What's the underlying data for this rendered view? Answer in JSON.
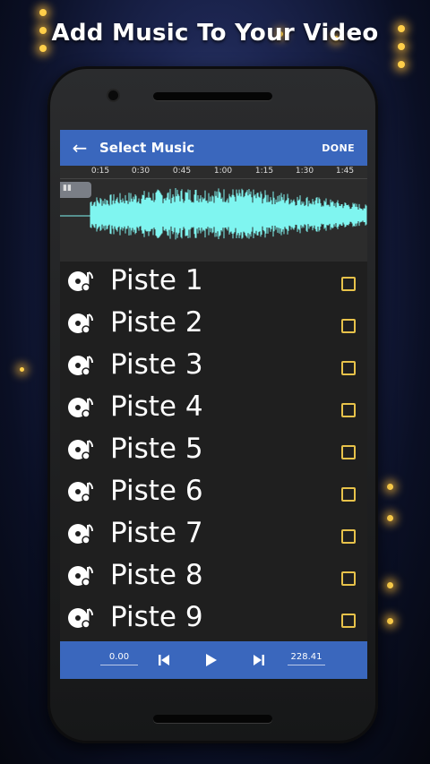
{
  "headline": "Add Music To Your Video",
  "appbar": {
    "title": "Select Music",
    "done_label": "DONE",
    "back_icon": "arrow-left-icon"
  },
  "waveform": {
    "ticks": [
      "0:15",
      "0:30",
      "0:45",
      "1:00",
      "1:15",
      "1:30",
      "1:45"
    ],
    "wave_color": "#7ff5f0"
  },
  "tracks": [
    {
      "label": "Piste 1",
      "checked": false
    },
    {
      "label": "Piste 2",
      "checked": false
    },
    {
      "label": "Piste 3",
      "checked": false
    },
    {
      "label": "Piste 4",
      "checked": false
    },
    {
      "label": "Piste 5",
      "checked": false
    },
    {
      "label": "Piste 6",
      "checked": false
    },
    {
      "label": "Piste 7",
      "checked": false
    },
    {
      "label": "Piste 8",
      "checked": false
    },
    {
      "label": "Piste 9",
      "checked": false
    }
  ],
  "controls": {
    "start_time": "0.00",
    "end_time": "228.41",
    "prev_icon": "skip-previous-icon",
    "play_icon": "play-icon",
    "next_icon": "skip-next-icon"
  },
  "colors": {
    "accent": "#3a67bd",
    "checkbox": "#e7c24a",
    "list_bg": "#1f1f1f"
  }
}
